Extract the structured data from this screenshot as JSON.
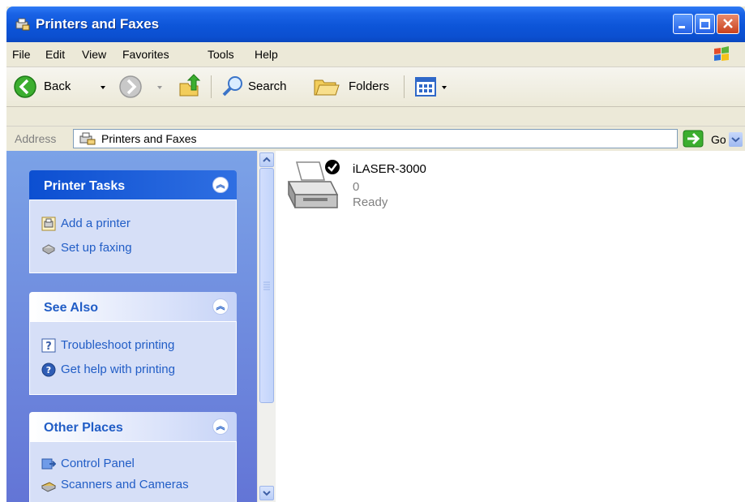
{
  "window": {
    "title": "Printers and Faxes"
  },
  "menu": [
    "File",
    "Edit",
    "View",
    "Favorites",
    "Tools",
    "Help"
  ],
  "toolbar": {
    "back_label": "Back",
    "search_label": "Search",
    "folders_label": "Folders"
  },
  "address": {
    "label": "Address",
    "value": "Printers and Faxes",
    "go_label": "Go"
  },
  "panels": {
    "printer_tasks": {
      "title": "Printer Tasks",
      "items": [
        "Add a printer",
        "Set up faxing"
      ]
    },
    "see_also": {
      "title": "See Also",
      "items": [
        "Troubleshoot printing",
        "Get help with printing"
      ]
    },
    "other_places": {
      "title": "Other Places",
      "items": [
        "Control Panel",
        "Scanners and Cameras"
      ]
    }
  },
  "printers": [
    {
      "name": "iLASER-3000",
      "documents": "0",
      "status": "Ready",
      "default": true
    }
  ],
  "icons": {
    "title": "printer-fax-icon",
    "back": "back-arrow-icon",
    "forward": "forward-arrow-icon",
    "up": "up-folder-icon",
    "search": "search-icon",
    "folders": "folders-icon",
    "views": "views-icon",
    "go": "go-arrow-icon",
    "add_printer": "add-printer-icon",
    "fax": "fax-icon",
    "troubleshoot": "question-icon",
    "help": "help-icon",
    "control_panel": "control-panel-icon",
    "scanners": "scanner-icon",
    "printer": "printer-icon",
    "default_check": "check-icon"
  },
  "colors": {
    "title_blue": "#0b4fd0",
    "task_link": "#215dc6",
    "panel_bg": "#d6dff7"
  }
}
